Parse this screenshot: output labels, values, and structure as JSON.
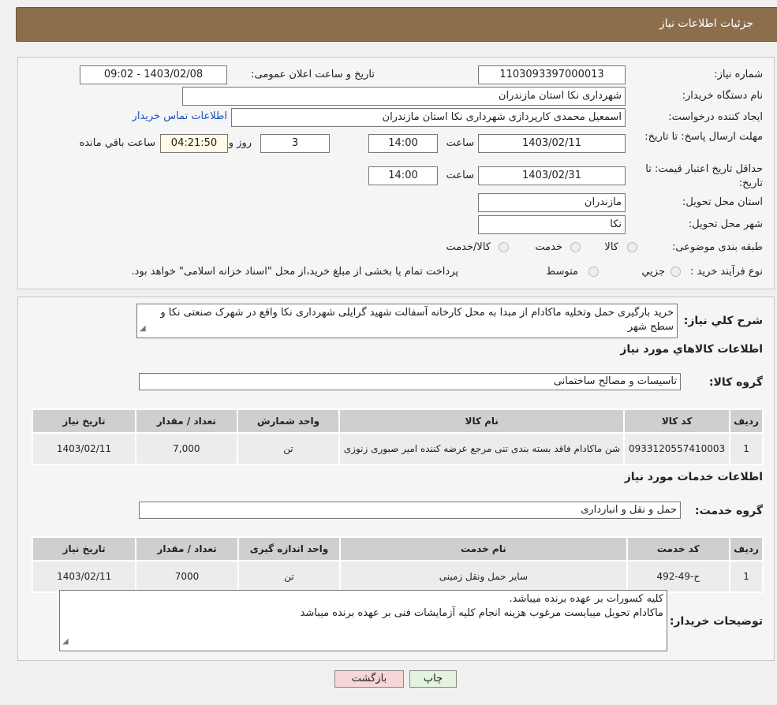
{
  "header": {
    "title": "جزئیات اطلاعات نیاز"
  },
  "form": {
    "need_number_label": "شماره نیاز:",
    "need_number": "1103093397000013",
    "announce_label": "تاریخ و ساعت اعلان عمومی:",
    "announce_value": "1403/02/08 - 09:02",
    "buyer_org_label": "نام دستگاه خریدار:",
    "buyer_org": "شهرداری نکا استان مازندران",
    "creator_label": "ایجاد کننده درخواست:",
    "creator": "اسمعیل محمدی کارپردازی شهرداری نکا استان مازندران",
    "contact_link": "اطلاعات تماس خریدار",
    "deadline_label": "مهلت ارسال پاسخ: تا تاریخ:",
    "deadline_date": "1403/02/11",
    "time_label": "ساعت",
    "deadline_time": "14:00",
    "days": "3",
    "days_label": "روز و",
    "remaining": "04:21:50",
    "remaining_label": "ساعت باقي مانده",
    "price_valid_label": "حداقل تاریخ اعتبار قیمت: تا تاریخ:",
    "price_valid_date": "1403/02/31",
    "price_valid_time": "14:00",
    "province_label": "استان محل تحویل:",
    "province": "مازندران",
    "city_label": "شهر محل تحویل:",
    "city": "نکا",
    "category_label": "طبقه بندی موضوعی:",
    "category_options": [
      "کالا",
      "خدمت",
      "کالا/خدمت"
    ],
    "process_label": "نوع فرآیند خرید :",
    "process_options": [
      "جزیي",
      "متوسط"
    ],
    "process_note": "پرداخت تمام یا بخشی از مبلغ خرید،از محل \"اسناد خزانه اسلامی\" خواهد بود."
  },
  "summary": {
    "label": "شرح کلي نياز:",
    "text": "خرید بارگیری حمل وتخلیه ماکادام از مبدا به محل کارخانه آسفالت شهید گرایلی شهرداری نکا واقع در شهرک صنعتی نکا و سطح شهر"
  },
  "goods": {
    "section_title": "اطلاعات کالاهاي مورد نياز",
    "group_label": "گروه کالا:",
    "group": "تاسیسات و مصالح ساختمانی",
    "headers": [
      "رديف",
      "کد کالا",
      "نام کالا",
      "واحد شمارش",
      "تعداد / مقدار",
      "تاريخ نياز"
    ],
    "rows": [
      [
        "1",
        "0933120557410003",
        "شن ماکادام فاقد بسته بندی تنی مرجع عرضه کننده امیر صبوری زنوزی",
        "تن",
        "7,000",
        "1403/02/11"
      ]
    ]
  },
  "services": {
    "section_title": "اطلاعات خدمات مورد نياز",
    "group_label": "گروه خدمت:",
    "group": "حمل و نقل و انبارداری",
    "headers": [
      "رديف",
      "کد خدمت",
      "نام خدمت",
      "واحد اندازه گیری",
      "تعداد / مقدار",
      "تاريخ نياز"
    ],
    "rows": [
      [
        "1",
        "ح-49-492",
        "سایر حمل ونقل زمینی",
        "تن",
        "7000",
        "1403/02/11"
      ]
    ]
  },
  "notes": {
    "label": "توضیحات خریدار:",
    "line1": "کلیه کسورات بر عهده برنده میباشد.",
    "line2": "ماکادام تحویل میبایست مرغوب هزینه انجام کلیه آزمایشات فنی بر عهده برنده میباشد"
  },
  "buttons": {
    "print": "چاپ",
    "back": "بازگشت"
  },
  "colors": {
    "header": "#8c6e4d",
    "link": "#1a4fbf",
    "back_button": "#f6d6d6",
    "print_button": "#e3f3e0"
  }
}
